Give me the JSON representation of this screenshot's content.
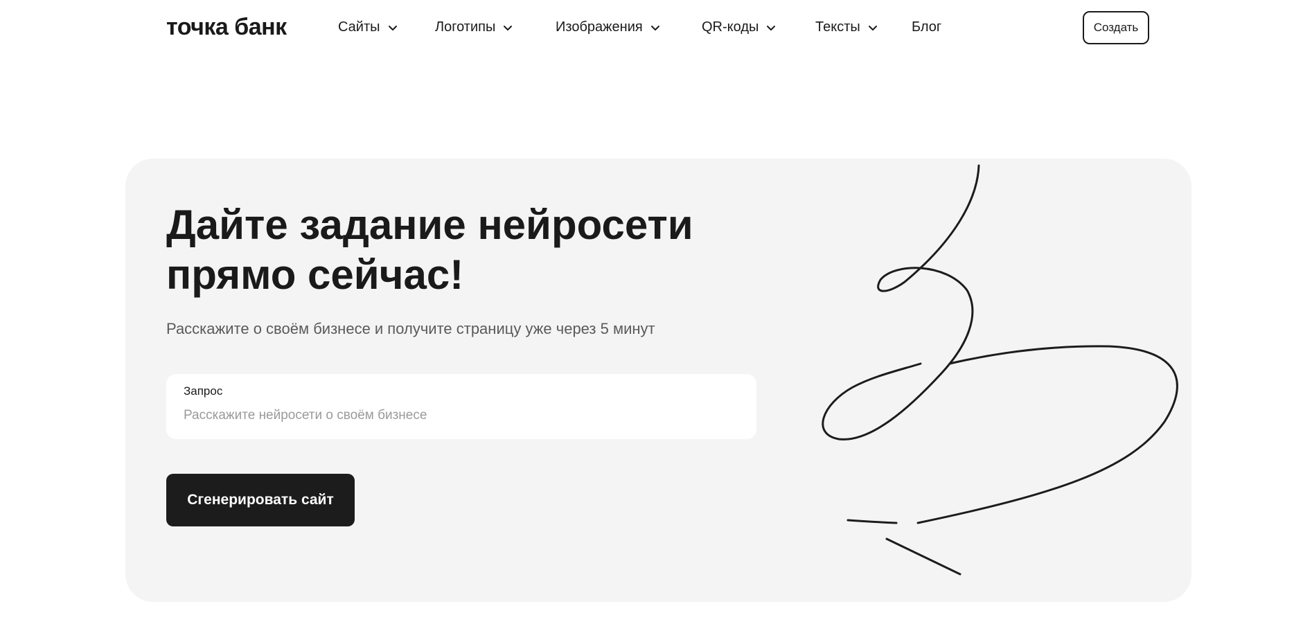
{
  "header": {
    "logo": "точка банк",
    "nav": [
      {
        "label": "Сайты",
        "has_dropdown": true
      },
      {
        "label": "Логотипы",
        "has_dropdown": true
      },
      {
        "label": "Изображения",
        "has_dropdown": true
      },
      {
        "label": "QR-коды",
        "has_dropdown": true
      },
      {
        "label": "Тексты",
        "has_dropdown": true
      },
      {
        "label": "Блог",
        "has_dropdown": false
      }
    ],
    "create_label": "Создать"
  },
  "hero": {
    "title_line1": "Дайте задание нейросети",
    "title_line2": "прямо сейчас!",
    "subtitle": "Расскажите о своём бизнесе и получите страницу уже через 5 минут",
    "field_label": "Запрос",
    "field_value": "",
    "field_placeholder": "Расскажите нейросети о своём бизнесе",
    "button_label": "Сгенерировать сайт"
  },
  "colors": {
    "background": "#ffffff",
    "hero_background": "#f4f4f4",
    "text": "#1a1a1a",
    "button": "#1c1c1c"
  }
}
